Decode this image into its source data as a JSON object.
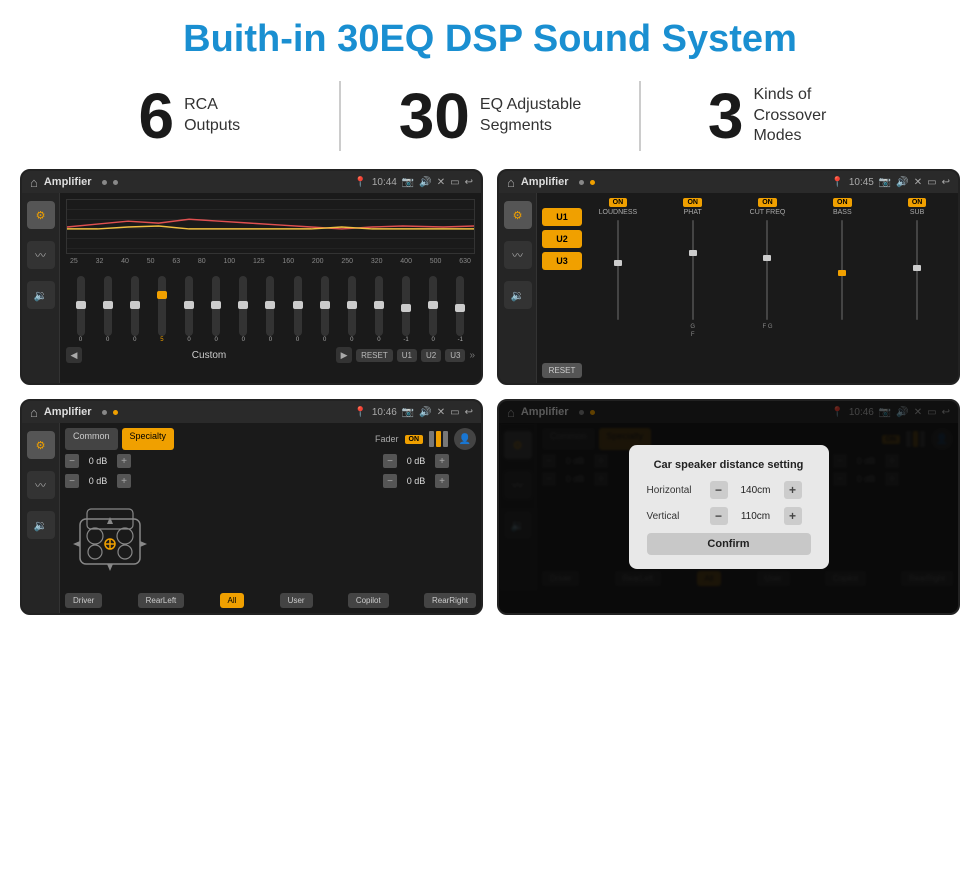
{
  "header": {
    "title": "Buith-in 30EQ DSP Sound System"
  },
  "stats": [
    {
      "number": "6",
      "label": "RCA\nOutputs"
    },
    {
      "number": "30",
      "label": "EQ Adjustable\nSegments"
    },
    {
      "number": "3",
      "label": "Kinds of\nCrossover Modes"
    }
  ],
  "screen1": {
    "statusbar": {
      "appName": "Amplifier",
      "time": "10:44"
    },
    "freqLabels": [
      "25",
      "32",
      "40",
      "50",
      "63",
      "80",
      "100",
      "125",
      "160",
      "200",
      "250",
      "320",
      "400",
      "500",
      "630"
    ],
    "sliderValues": [
      "0",
      "0",
      "0",
      "5",
      "0",
      "0",
      "0",
      "0",
      "0",
      "0",
      "0",
      "0",
      "-1",
      "0",
      "-1"
    ],
    "presetName": "Custom",
    "buttons": [
      "RESET",
      "U1",
      "U2",
      "U3"
    ]
  },
  "screen2": {
    "statusbar": {
      "appName": "Amplifier",
      "time": "10:45"
    },
    "channels": [
      {
        "name": "LOUDNESS"
      },
      {
        "name": "PHAT"
      },
      {
        "name": "CUT FREQ"
      },
      {
        "name": "BASS"
      },
      {
        "name": "SUB"
      }
    ],
    "uButtons": [
      "U1",
      "U2",
      "U3"
    ],
    "resetLabel": "RESET"
  },
  "screen3": {
    "statusbar": {
      "appName": "Amplifier",
      "time": "10:46"
    },
    "tabs": [
      "Common",
      "Specialty"
    ],
    "activeTab": "Specialty",
    "faderLabel": "Fader",
    "faderOn": "ON",
    "volumes": [
      {
        "label": "0 dB"
      },
      {
        "label": "0 dB"
      },
      {
        "label": "0 dB"
      },
      {
        "label": "0 dB"
      }
    ],
    "bottomButtons": [
      "Driver",
      "RearLeft",
      "All",
      "User",
      "Copilot",
      "RearRight"
    ]
  },
  "screen4": {
    "statusbar": {
      "appName": "Amplifier",
      "time": "10:46"
    },
    "tabs": [
      "Common",
      "Specialty"
    ],
    "dialog": {
      "title": "Car speaker distance setting",
      "rows": [
        {
          "label": "Horizontal",
          "value": "140cm"
        },
        {
          "label": "Vertical",
          "value": "110cm"
        }
      ],
      "confirmLabel": "Confirm"
    },
    "volumes": [
      {
        "label": "0 dB"
      },
      {
        "label": "0 dB"
      }
    ],
    "bottomButtons": [
      "Driver",
      "RearLeft",
      "All",
      "User",
      "Copilot",
      "RearRight"
    ]
  }
}
